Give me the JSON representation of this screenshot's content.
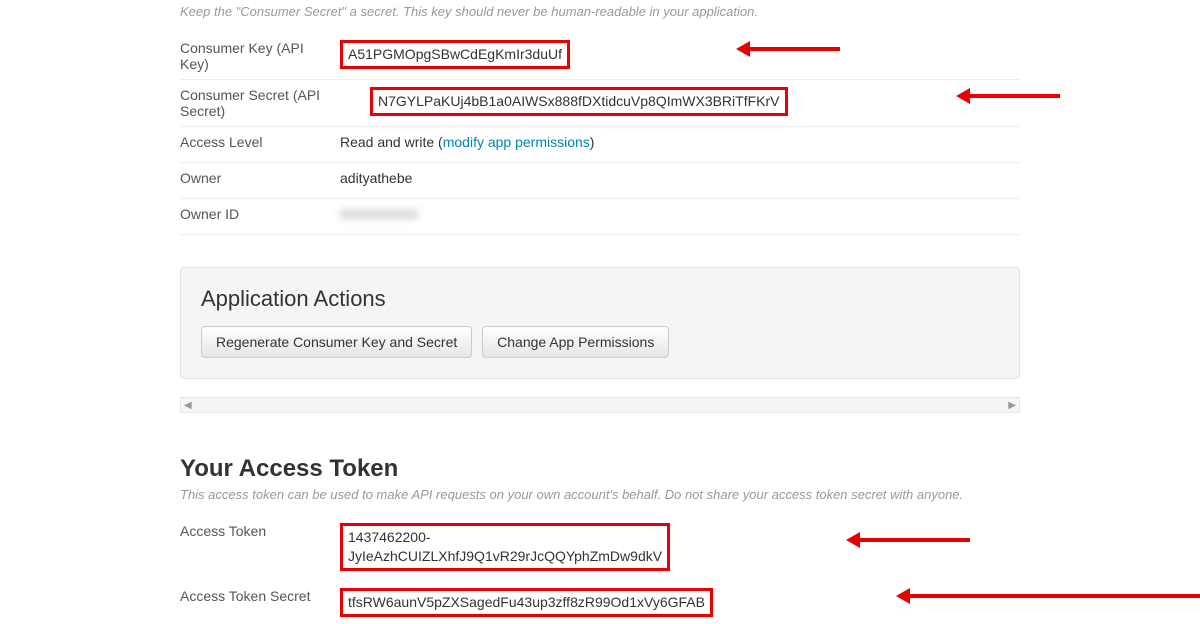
{
  "hint1": "Keep the \"Consumer Secret\" a secret. This key should never be human-readable in your application.",
  "rows": {
    "consumer_key": {
      "label": "Consumer Key (API Key)",
      "value": "A51PGMOpgSBwCdEgKmIr3duUf"
    },
    "consumer_secret": {
      "label": "Consumer Secret (API Secret)",
      "value": "N7GYLPaKUj4bB1a0AIWSx888fDXtidcuVp8QImWX3BRiTfFKrV"
    },
    "access_level": {
      "label": "Access Level",
      "prefix": "Read and write (",
      "link": "modify app permissions",
      "suffix": ")"
    },
    "owner": {
      "label": "Owner",
      "value": "adityathebe"
    },
    "owner_id": {
      "label": "Owner ID",
      "value": "0000000000"
    }
  },
  "actions": {
    "title": "Application Actions",
    "regen": "Regenerate Consumer Key and Secret",
    "change": "Change App Permissions"
  },
  "token_section": {
    "title": "Your Access Token",
    "hint": "This access token can be used to make API requests on your own account's behalf. Do not share your access token secret with anyone.",
    "access_token": {
      "label": "Access Token",
      "line1": "1437462200-",
      "line2": "JyIeAzhCUIZLXhfJ9Q1vR29rJcQQYphZmDw9dkV"
    },
    "access_token_secret": {
      "label": "Access Token Secret",
      "value": "tfsRW6aunV5pZXSagedFu43up3zff8zR99Od1xVy6GFAB"
    }
  }
}
